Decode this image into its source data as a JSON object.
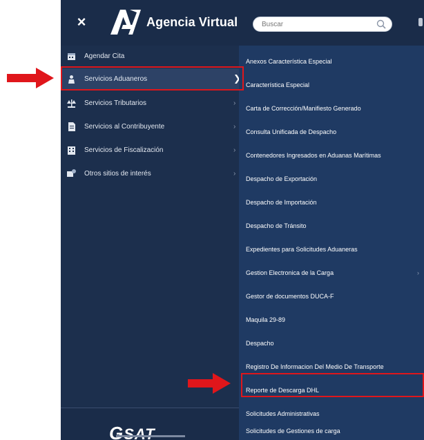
{
  "header": {
    "title": "Agencia Virtual",
    "close_symbol": "×",
    "search_placeholder": "Buscar"
  },
  "sidebar": {
    "items": [
      {
        "label": "Agendar Cita",
        "icon": "calendar-icon"
      },
      {
        "label": "Servicios Aduaneros",
        "icon": "customs-officer-icon",
        "active": true
      },
      {
        "label": "Servicios Tributarios",
        "icon": "scale-icon"
      },
      {
        "label": "Servicios al Contribuyente",
        "icon": "document-icon"
      },
      {
        "label": "Servicios de Fiscalización",
        "icon": "building-icon"
      },
      {
        "label": "Otros sitios de interés",
        "icon": "sites-icon"
      }
    ],
    "footer_logo": "SAT"
  },
  "submenu": {
    "items": [
      {
        "label": "Anexos Característica Especial"
      },
      {
        "label": "Característica Especial"
      },
      {
        "label": "Carta de Corrección/Manifiesto Generado"
      },
      {
        "label": "Consulta Unificada de Despacho"
      },
      {
        "label": "Contenedores Ingresados en Aduanas Marítimas"
      },
      {
        "label": "Despacho de Exportación"
      },
      {
        "label": "Despacho de Importación"
      },
      {
        "label": "Despacho de Tránsito"
      },
      {
        "label": "Expedientes para Solicitudes Aduaneras"
      },
      {
        "label": "Gestion Electronica de la Carga",
        "has_children": true
      },
      {
        "label": "Gestor de documentos DUCA-F"
      },
      {
        "label": "Maquila 29-89"
      },
      {
        "label": "Despacho"
      },
      {
        "label": "Registro De Informacion Del Medio De Transporte"
      },
      {
        "label": "Reporte de Descarga DHL",
        "highlighted": true
      },
      {
        "label": "Solicitudes Administrativas"
      },
      {
        "label": "Solicitudes de Gestiones de carga"
      }
    ]
  },
  "colors": {
    "sidebar_bg": "#1c2f4d",
    "submenu_bg": "#1f3a63",
    "highlight": "#e0161b",
    "text": "#ffffff"
  }
}
